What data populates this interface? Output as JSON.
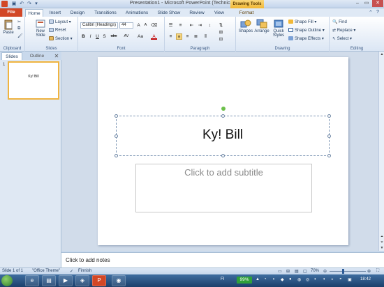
{
  "window": {
    "title": "Presentation1 - Microsoft PowerPoint (Technical Preview)",
    "context_tab_header": "Drawing Tools",
    "controls": {
      "minimize": "–",
      "restore": "▭",
      "close": "✕"
    }
  },
  "tabs": [
    "File",
    "Home",
    "Insert",
    "Design",
    "Transitions",
    "Animations",
    "Slide Show",
    "Review",
    "View",
    "Format"
  ],
  "ribbon": {
    "clipboard": {
      "paste": "Paste",
      "label": "Clipboard"
    },
    "slides": {
      "new_slide_line1": "New",
      "new_slide_line2": "Slide",
      "layout": "Layout",
      "reset": "Reset",
      "section": "Section",
      "label": "Slides"
    },
    "font": {
      "font_name": "Calibri (Headings)",
      "font_size": "44",
      "label": "Font",
      "bold": "B",
      "italic": "I",
      "underline": "U",
      "shadow": "S",
      "strike": "abc",
      "spacing": "AV",
      "case": "Aa",
      "color": "A"
    },
    "paragraph": {
      "label": "Paragraph"
    },
    "drawing": {
      "shapes": "Shapes",
      "arrange": "Arrange",
      "quick_styles_line1": "Quick",
      "quick_styles_line2": "Styles",
      "shape_fill": "Shape Fill",
      "shape_outline": "Shape Outline",
      "shape_effects": "Shape Effects",
      "label": "Drawing"
    },
    "editing": {
      "find": "Find",
      "replace": "Replace",
      "select": "Select",
      "label": "Editing"
    }
  },
  "left_pane": {
    "tab_slides": "Slides",
    "tab_outline": "Outline",
    "close": "✕",
    "slide_number": "1",
    "thumbnail_title": "Ky! Bill"
  },
  "slide": {
    "title": "Ky! Bill",
    "subtitle_placeholder": "Click to add subtitle"
  },
  "notes": {
    "placeholder": "Click to add notes"
  },
  "statusbar": {
    "slide_info": "Slide 1 of 1",
    "theme": "\"Office Theme\"",
    "language": "Finnish",
    "zoom": "70%"
  },
  "taskbar": {
    "battery": "99%",
    "lang": "FI",
    "time": "18:42"
  },
  "colors": {
    "file_tab": "#d24726",
    "ribbon_text": "#1e395b",
    "drawing_tools": "#f2b836",
    "selection_border": "#f0b440"
  }
}
